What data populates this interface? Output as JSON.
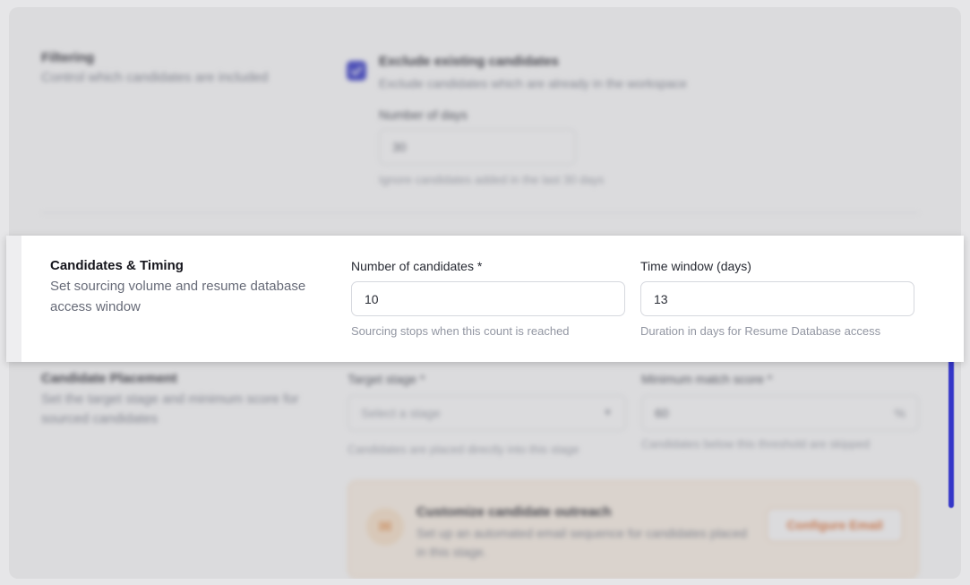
{
  "filtering": {
    "title": "Filtering",
    "description": "Control which candidates are included",
    "exclude_label": "Exclude existing candidates",
    "exclude_description": "Exclude candidates which are already in the workspace",
    "exclude_checked": true,
    "days_label": "Number of days",
    "days_value": "30",
    "days_hint": "Ignore candidates added in the last 30 days"
  },
  "candidates_timing": {
    "title": "Candidates & Timing",
    "description": "Set sourcing volume and resume database access window",
    "count_label": "Number of candidates *",
    "count_value": "10",
    "count_hint": "Sourcing stops when this count is reached",
    "window_label": "Time window (days)",
    "window_value": "13",
    "window_hint": "Duration in days for Resume Database access"
  },
  "placement": {
    "title": "Candidate Placement",
    "description": "Set the target stage and minimum score for sourced candidates",
    "stage_label": "Target stage *",
    "stage_placeholder": "Select a stage",
    "stage_hint": "Candidates are placed directly into this stage",
    "score_label": "Minimum match score *",
    "score_value": "60",
    "score_unit": "%",
    "score_hint": "Candidates below this threshold are skipped"
  },
  "outreach": {
    "title": "Customize candidate outreach",
    "description": "Set up an automated email sequence for candidates placed in this stage.",
    "button_label": "Configure Email"
  },
  "colors": {
    "accent": "#2b2fc7",
    "outreach_orange": "#e06a2a"
  }
}
